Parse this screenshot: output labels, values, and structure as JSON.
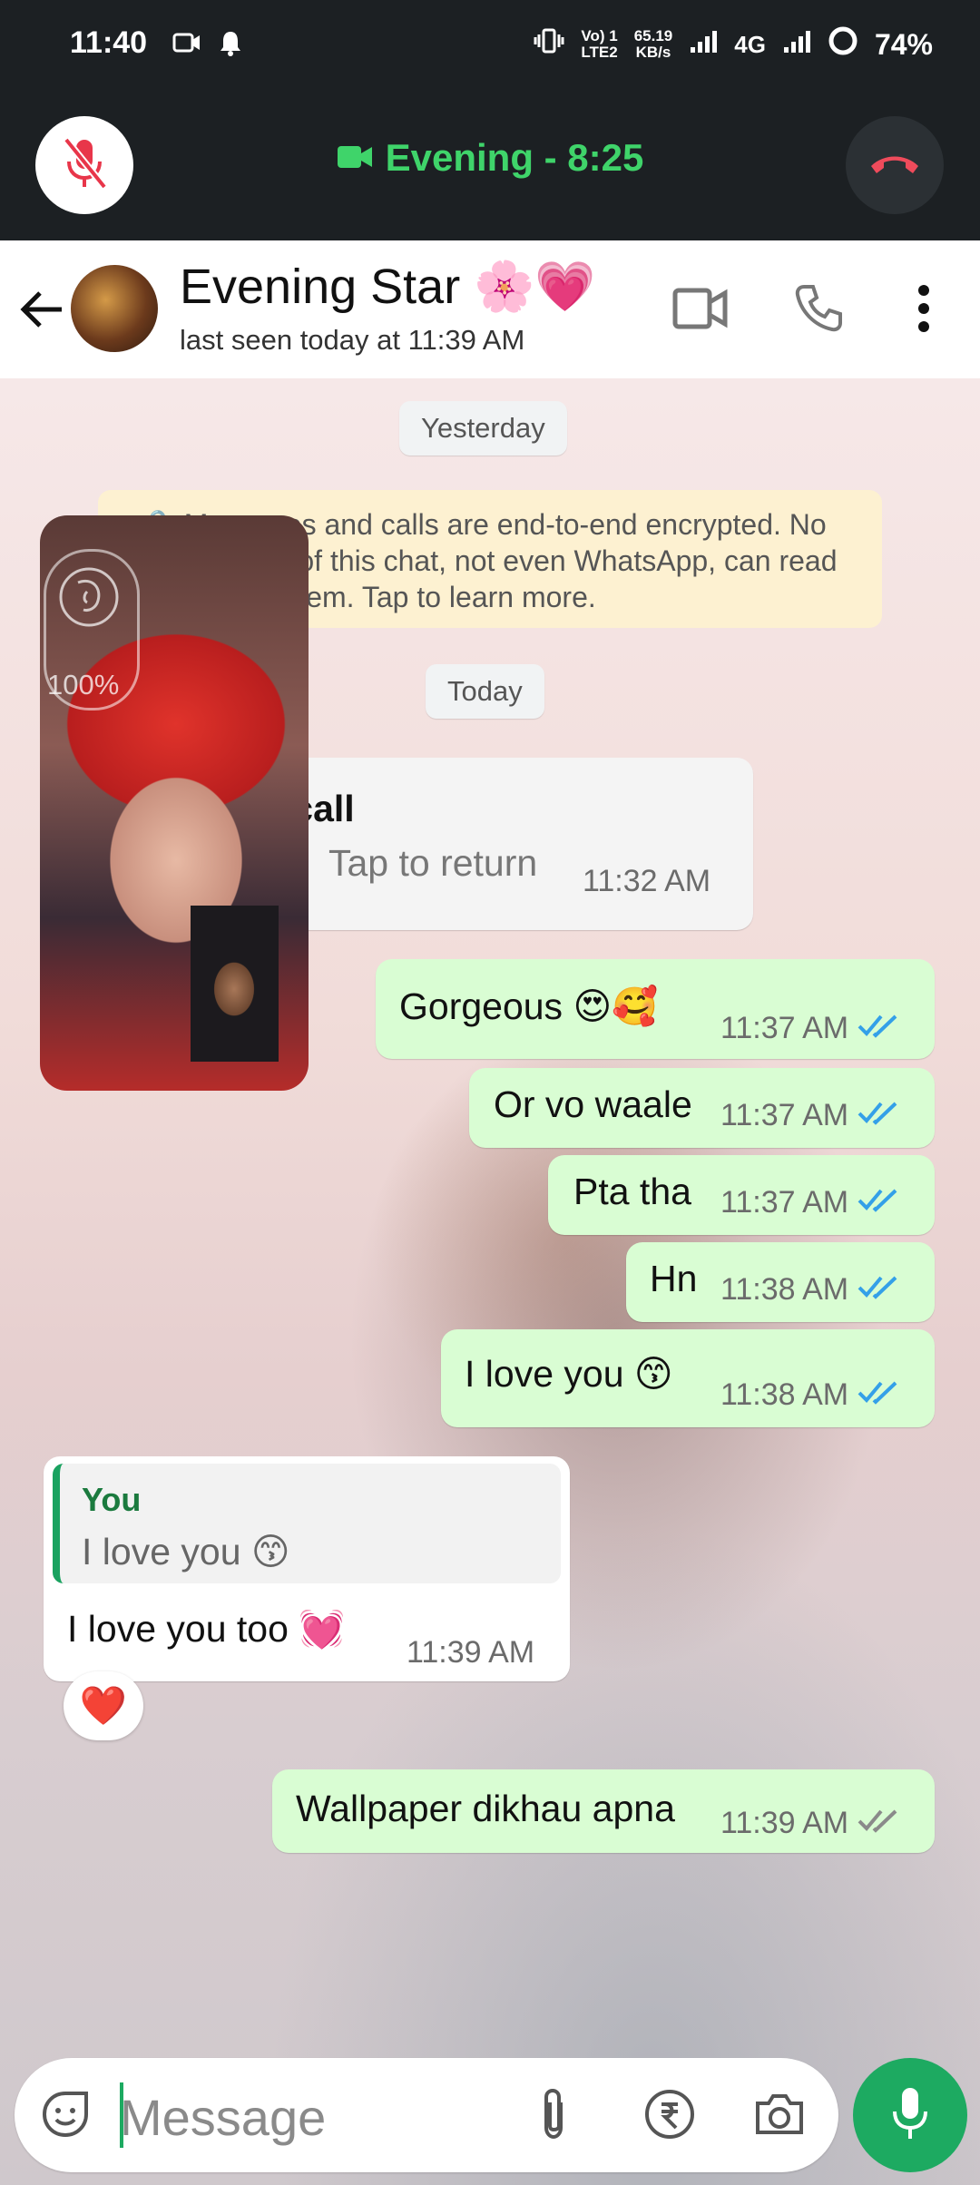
{
  "status_bar": {
    "time": "11:40",
    "net_top": "Vo) 1",
    "net_bottom": "LTE2",
    "speed_top": "65.19",
    "speed_bottom": "KB/s",
    "network": "4G",
    "battery": "74%"
  },
  "call_bar": {
    "title": "Evening - 8:25"
  },
  "header": {
    "contact_name": "Evening Star 🌸💗",
    "last_seen": "last seen today at 11:39 AM"
  },
  "chat": {
    "date_yesterday": "Yesterday",
    "encryption_note": "🔒 Messages and calls are end-to-end encrypted. No one outside of this chat, not even WhatsApp, can read or listen to them. Tap to learn more.",
    "date_today": "Today",
    "call_card": {
      "title": "Video call",
      "subtitle": "Tap to return",
      "time": "11:32 AM"
    },
    "messages": [
      {
        "text": "Gorgeous 😍🥰",
        "time": "11:37 AM"
      },
      {
        "text": "Or vo waale",
        "time": "11:37 AM"
      },
      {
        "text": "Pta tha",
        "time": "11:37 AM"
      },
      {
        "text": "Hn",
        "time": "11:38 AM"
      },
      {
        "text": "I love you 😙",
        "time": "11:38 AM"
      }
    ],
    "reply": {
      "quoted_author": "You",
      "quoted_text": "I love you 😙",
      "text": "I love you too 💓",
      "time": "11:39 AM",
      "reaction": "❤️"
    },
    "last_message": {
      "text": "Wallpaper dikhau apna",
      "time": "11:39 AM"
    }
  },
  "pip": {
    "beauty_level": "100%"
  },
  "input": {
    "placeholder": "Message"
  },
  "colors": {
    "accent_green": "#1daa61",
    "call_green": "#3fd46a",
    "read_tick_blue": "#34a0e8",
    "end_call_red": "#ef4b5b"
  }
}
